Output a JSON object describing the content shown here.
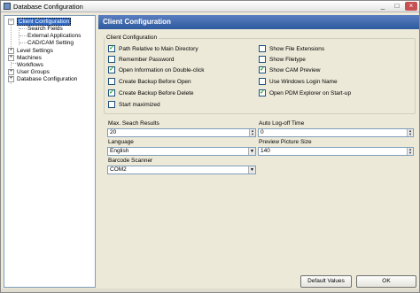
{
  "window": {
    "title": "Database Configuration"
  },
  "tree": {
    "items": [
      {
        "label": "Client Configuration",
        "selected": true,
        "expander": "−"
      },
      {
        "label": "Search Fields"
      },
      {
        "label": "External Applications"
      },
      {
        "label": "CAD/CAM Setting"
      },
      {
        "label": "Level Settings",
        "expander": "+"
      },
      {
        "label": "Machines",
        "expander": "+"
      },
      {
        "label": "Workflows"
      },
      {
        "label": "User Groups",
        "expander": "+"
      },
      {
        "label": "Database Configuration",
        "expander": "+"
      }
    ]
  },
  "panel": {
    "header": "Client Configuration",
    "group_title": "Client Configuration",
    "checkboxes_left": [
      {
        "label": "Path Relative to Main Directory",
        "checked": true
      },
      {
        "label": "Remember Password",
        "checked": false
      },
      {
        "label": "Open Information on Double-click",
        "checked": true
      },
      {
        "label": "Create Backup Before Open",
        "checked": false
      },
      {
        "label": "Create Backup Before Delete",
        "checked": true
      },
      {
        "label": "Start maximized",
        "checked": false
      }
    ],
    "checkboxes_right": [
      {
        "label": "Show File Extensions",
        "checked": false
      },
      {
        "label": "Show Filetype",
        "checked": false
      },
      {
        "label": "Show CAM Preview",
        "checked": true
      },
      {
        "label": "Use Windows Login Name",
        "checked": false
      },
      {
        "label": "Open PDM Explorer on Start-up",
        "checked": true
      }
    ],
    "fields": {
      "max_search": {
        "label": "Max. Seach Results",
        "value": "20"
      },
      "auto_logoff": {
        "label": "Auto Log-off Time",
        "value": "0"
      },
      "language": {
        "label": "Language",
        "value": "English"
      },
      "preview_size": {
        "label": "Preview Picture Size",
        "value": "140"
      },
      "barcode": {
        "label": "Barcode Scanner",
        "value": "COM2"
      }
    }
  },
  "footer": {
    "default_values": "Default Values",
    "ok": "OK"
  },
  "icons": {
    "checkmark": "✓",
    "spin_up": "▲",
    "spin_down": "▼",
    "dropdown": "▼"
  }
}
